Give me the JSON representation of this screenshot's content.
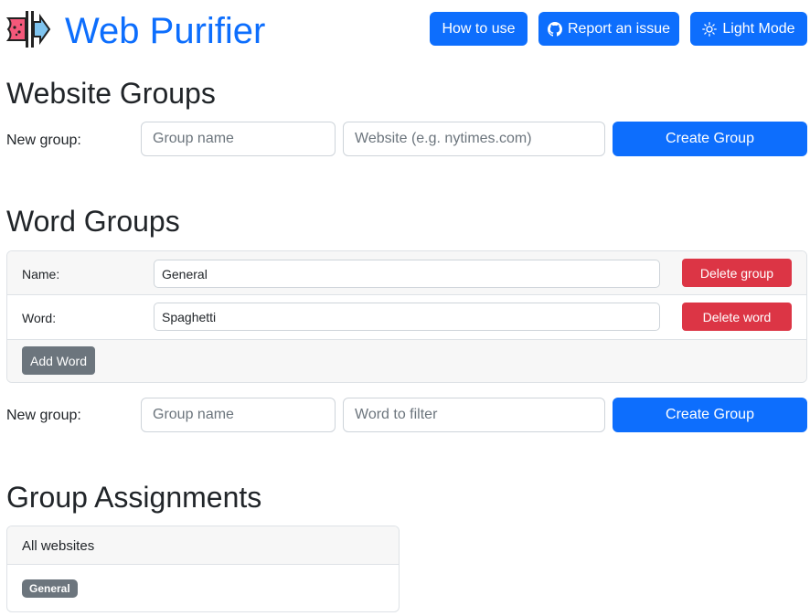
{
  "header": {
    "brand": "Web Purifier",
    "buttons": {
      "how_to_use": "How to use",
      "report_issue": "Report an issue",
      "light_mode": "Light Mode"
    }
  },
  "website_groups": {
    "title": "Website Groups",
    "new_group_label": "New group:",
    "group_name_placeholder": "Group name",
    "website_placeholder": "Website (e.g. nytimes.com)",
    "create_button": "Create Group"
  },
  "word_groups": {
    "title": "Word Groups",
    "group": {
      "name_label": "Name:",
      "name_value": "General",
      "delete_group_button": "Delete group",
      "word_label": "Word:",
      "word_value": "Spaghetti",
      "delete_word_button": "Delete word",
      "add_word_button": "Add Word"
    },
    "new_group_label": "New group:",
    "group_name_placeholder": "Group name",
    "word_placeholder": "Word to filter",
    "create_button": "Create Group"
  },
  "group_assignments": {
    "title": "Group Assignments",
    "card_header": "All websites",
    "badges": [
      "General"
    ]
  },
  "colors": {
    "primary": "#0d6efd",
    "danger": "#dc3545",
    "secondary": "#6c757d"
  },
  "icons": {
    "logo": "purifier-logo-icon",
    "github": "github-icon",
    "light_mode": "sun-icon"
  }
}
